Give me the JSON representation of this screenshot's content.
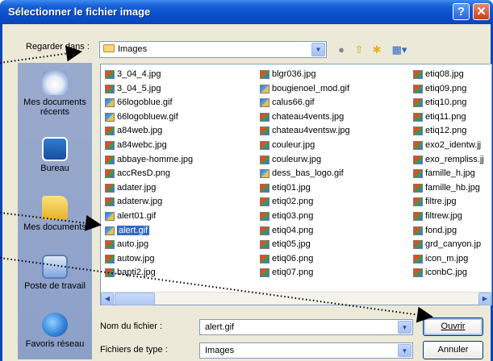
{
  "window": {
    "title": "Sélectionner le fichier image",
    "help": "?",
    "close": "✕"
  },
  "lookin": {
    "label": "Regarder dans :",
    "value": "Images"
  },
  "toolbar": {
    "back": "back-icon",
    "up": "folder-up-icon",
    "new": "new-folder-icon",
    "view": "view-menu-icon"
  },
  "places": [
    {
      "label": "Mes documents récents",
      "icon": "recent-documents-icon"
    },
    {
      "label": "Bureau",
      "icon": "desktop-icon"
    },
    {
      "label": "Mes documents",
      "icon": "my-documents-icon"
    },
    {
      "label": "Poste de travail",
      "icon": "my-computer-icon"
    },
    {
      "label": "Favoris réseau",
      "icon": "network-places-icon"
    }
  ],
  "files": {
    "col1": [
      "3_04_4.jpg",
      "3_04_5.jpg",
      "66logoblue.gif",
      "66logobluew.gif",
      "a84web.jpg",
      "a84webc.jpg",
      "abbaye-homme.jpg",
      "accResD.png",
      "adater.jpg",
      "adaterw.jpg",
      "alert01.gif",
      "alert.gif",
      "auto.jpg",
      "autow.jpg",
      "bapti2.jpg"
    ],
    "col2": [
      "blgr036.jpg",
      "bougienoel_mod.gif",
      "calus66.gif",
      "chateau4vents.jpg",
      "chateau4ventsw.jpg",
      "couleur.jpg",
      "couleurw.jpg",
      "dess_bas_logo.gif",
      "etiq01.jpg",
      "etiq02.png",
      "etiq03.png",
      "etiq04.png",
      "etiq05.jpg",
      "etiq06.png",
      "etiq07.png"
    ],
    "col3": [
      "etiq08.jpg",
      "etiq09.png",
      "etiq10.png",
      "etiq11.png",
      "etiq12.png",
      "exo2_identw.jj",
      "exo_rempliss.jj",
      "famille_h.jpg",
      "famille_hb.jpg",
      "filtre.jpg",
      "filtrew.jpg",
      "fond.jpg",
      "grd_canyon.jp",
      "icon_m.jpg",
      "iconbC.jpg"
    ],
    "selected": "alert.gif"
  },
  "filename": {
    "label": "Nom du fichier :",
    "value": "alert.gif"
  },
  "filetype": {
    "label": "Fichiers de type :",
    "value": "Images"
  },
  "buttons": {
    "open": "Ouvrir",
    "cancel": "Annuler"
  }
}
